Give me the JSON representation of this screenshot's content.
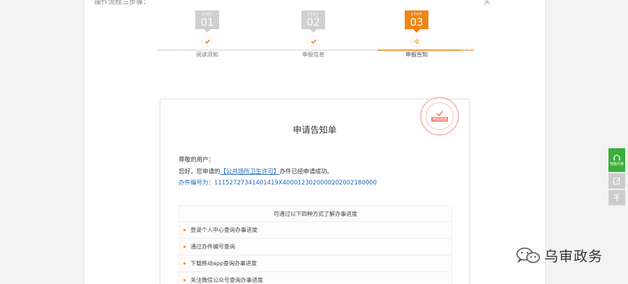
{
  "header": {
    "note": "操作流程三步骤：",
    "close": "关"
  },
  "stepper": {
    "steps": [
      {
        "tag": "STEP",
        "number": "01",
        "label": "阅读须知",
        "state": "done"
      },
      {
        "tag": "STEP",
        "number": "02",
        "label": "申报信息",
        "state": "done"
      },
      {
        "tag": "STEP",
        "number": "03",
        "label": "申报告知",
        "state": "active"
      }
    ]
  },
  "card": {
    "title": "申请告知单",
    "stamp": "申报完成",
    "greeting": "尊敬的用户：",
    "msg_prefix": "您好，您申请的",
    "permit_name": "【公共场所卫生许可】",
    "msg_suffix": "办件已经申请成功。",
    "app_no_label": "办件编号为：",
    "app_no": "11152727341401419X40001230200002020021800​00"
  },
  "progress": {
    "title": "可通过以下四种方式了解办事进度",
    "items": [
      "登录个人中心查询办事进度",
      "通过办件编号查询",
      "下载移动app查询办事进度",
      "关注微信公众号查询办事进度"
    ]
  },
  "float_tools": {
    "consult_label": "智能问答",
    "items": [
      "headset-icon",
      "edit-icon",
      "back-to-top-icon"
    ]
  },
  "watermark": {
    "text": "乌审政务"
  },
  "colors": {
    "accent": "#f08519",
    "link": "#1d67b8",
    "green": "#3aae3a"
  }
}
